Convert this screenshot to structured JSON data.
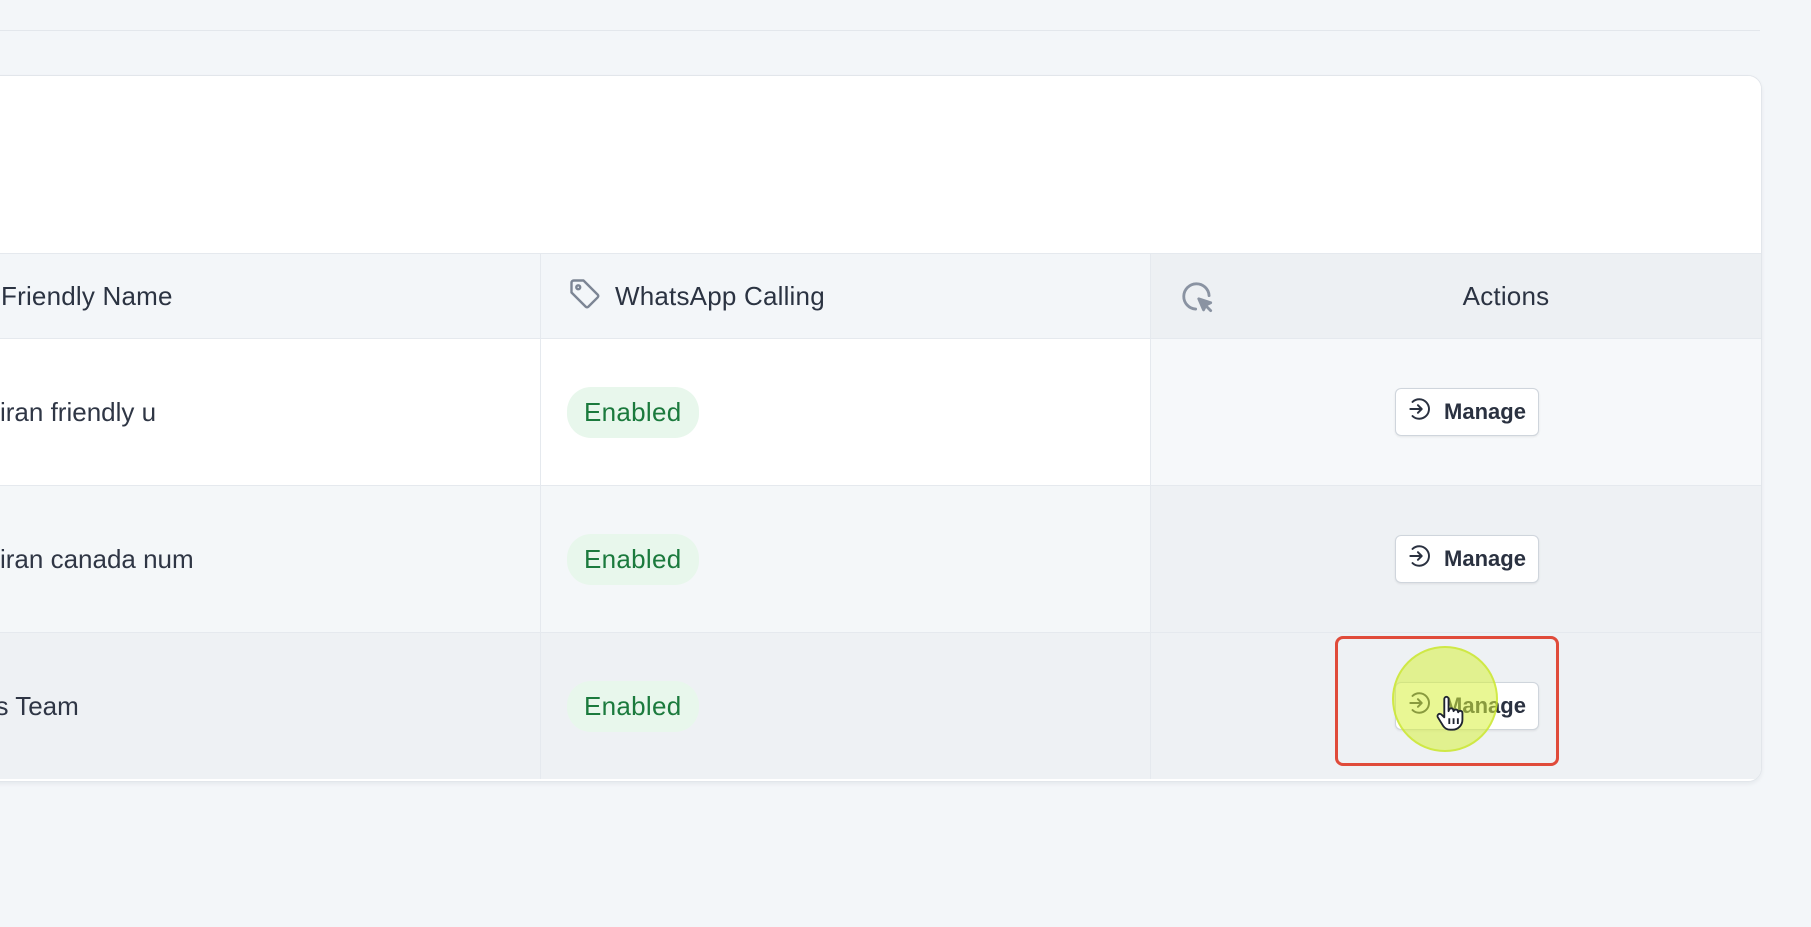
{
  "table": {
    "headers": {
      "friendly_name": "Friendly Name",
      "whatsapp_calling": "WhatsApp Calling",
      "actions": "Actions"
    },
    "rows": [
      {
        "friendly_name": "kiran friendly u",
        "whatsapp_calling": "Enabled",
        "action_label": "Manage"
      },
      {
        "friendly_name": "kiran canada num",
        "whatsapp_calling": "Enabled",
        "action_label": "Manage"
      },
      {
        "friendly_name": "es Team",
        "whatsapp_calling": "Enabled",
        "action_label": "Manage"
      }
    ]
  },
  "colors": {
    "badge_bg": "#e8f7ec",
    "badge_text": "#1b7a3d",
    "highlight": "#e04b3a",
    "click_indicator": "#d7f03c"
  },
  "icons": {
    "whatsapp_calling_header": "tag-icon",
    "actions_header": "cursor-click-icon",
    "manage_button": "arrow-right-circle-icon",
    "pointer": "hand-pointer-icon"
  }
}
